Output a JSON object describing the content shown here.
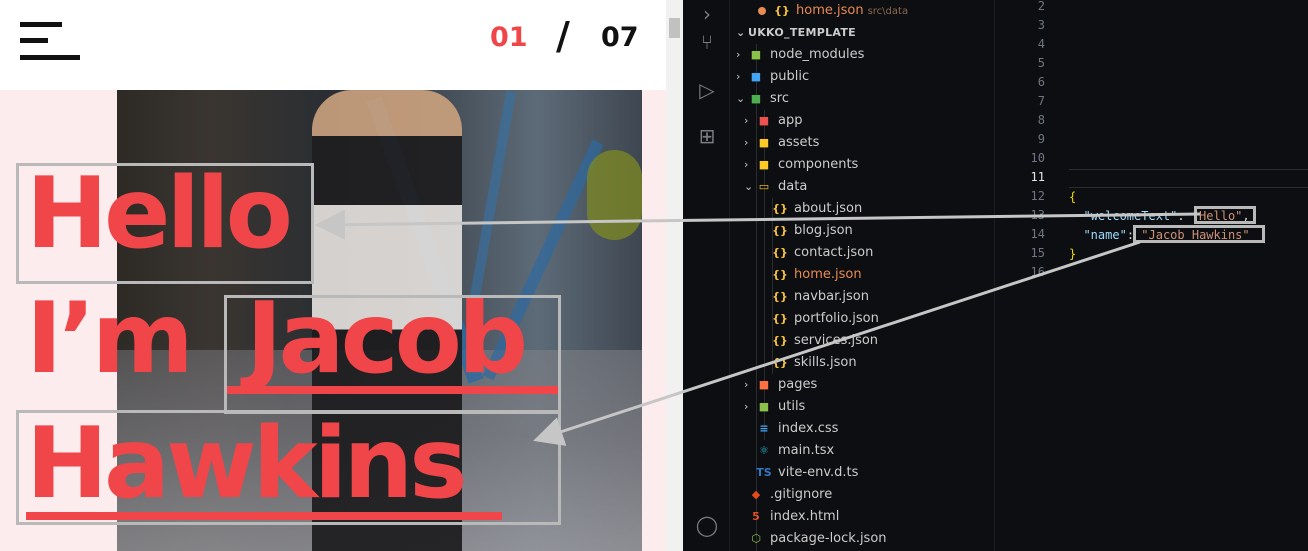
{
  "site": {
    "counter": {
      "current": "01",
      "separator": "/",
      "total": "07"
    },
    "hero": {
      "line1": "Hello",
      "line2": "I’m",
      "name_first": "Jacob",
      "name_last": "Hawkins"
    }
  },
  "explorer": {
    "open_editor": {
      "name": "home.json",
      "path": "src\\data"
    },
    "project": "UKKO_TEMPLATE",
    "items": [
      {
        "label": "node_modules",
        "icon": "folder-node-icon",
        "color": "#8bc34a"
      },
      {
        "label": "public",
        "icon": "folder-public-icon",
        "color": "#42a5f5"
      },
      {
        "label": "src",
        "icon": "folder-src-icon",
        "color": "#4caf50"
      },
      {
        "label": "app",
        "icon": "folder-app-icon",
        "color": "#ef5350"
      },
      {
        "label": "assets",
        "icon": "folder-icon",
        "color": "#ffca28"
      },
      {
        "label": "components",
        "icon": "folder-icon",
        "color": "#ffca28"
      },
      {
        "label": "data",
        "icon": "folder-open-icon",
        "color": "#ffca28"
      },
      {
        "label": "about.json",
        "icon": "json-icon",
        "color": "#f9c23c"
      },
      {
        "label": "blog.json",
        "icon": "json-icon",
        "color": "#f9c23c"
      },
      {
        "label": "contact.json",
        "icon": "json-icon",
        "color": "#f9c23c"
      },
      {
        "label": "home.json",
        "icon": "json-icon",
        "color": "#f9c23c"
      },
      {
        "label": "navbar.json",
        "icon": "json-icon",
        "color": "#f9c23c"
      },
      {
        "label": "portfolio.json",
        "icon": "json-icon",
        "color": "#f9c23c"
      },
      {
        "label": "services.json",
        "icon": "json-icon",
        "color": "#f9c23c"
      },
      {
        "label": "skills.json",
        "icon": "json-icon",
        "color": "#f9c23c"
      },
      {
        "label": "pages",
        "icon": "folder-icon",
        "color": "#ff7043"
      },
      {
        "label": "utils",
        "icon": "folder-icon",
        "color": "#8bc34a"
      },
      {
        "label": "index.css",
        "icon": "css-icon",
        "color": "#42a5f5"
      },
      {
        "label": "main.tsx",
        "icon": "react-icon",
        "color": "#26c6da"
      },
      {
        "label": "vite-env.d.ts",
        "icon": "typescript-icon",
        "color": "#3178c6"
      },
      {
        "label": ".gitignore",
        "icon": "git-icon",
        "color": "#e64a19"
      },
      {
        "label": "index.html",
        "icon": "html-icon",
        "color": "#e44d26"
      },
      {
        "label": "package-lock.json",
        "icon": "npm-icon",
        "color": "#8bc34a"
      }
    ]
  },
  "editor": {
    "line_numbers": [
      "2",
      "3",
      "4",
      "5",
      "6",
      "7",
      "8",
      "9",
      "10",
      "11",
      "12",
      "13",
      "14",
      "15",
      "16"
    ],
    "active_line": "11",
    "code": {
      "open_brace": "{",
      "key1": "\"welcomeText\"",
      "val1": "\"Hello\"",
      "key2": "\"name\"",
      "val2": "\"Jacob Hawkins\"",
      "close_brace": "}"
    }
  },
  "colors": {
    "accent": "#f0464a",
    "modified": "#e88b52"
  }
}
